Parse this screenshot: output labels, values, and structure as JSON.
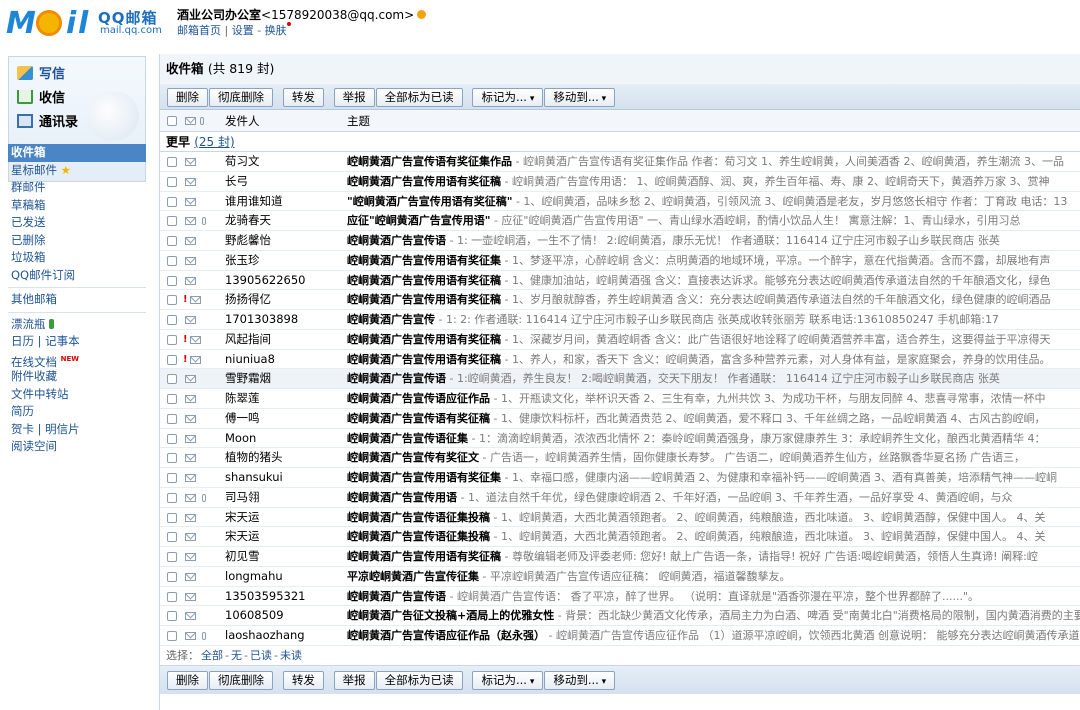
{
  "header": {
    "logo_brand": "QQ邮箱",
    "logo_domain": "mail.qq.com",
    "account_name": "酒业公司办公室",
    "account_email": "<1578920038@qq.com>",
    "link_home": "邮箱首页",
    "link_settings": "设置",
    "link_switch": "换肤"
  },
  "sidebar": {
    "write": "写信",
    "receive": "收信",
    "contacts": "通讯录",
    "folders": [
      "收件箱",
      "星标邮件",
      "群邮件",
      "草稿箱",
      "已发送",
      "已删除",
      "垃圾箱",
      "QQ邮件订阅"
    ],
    "other_mail": "其他邮箱",
    "extras": [
      "漂流瓶",
      "日历 | 记事本",
      "在线文档",
      "附件收藏",
      "文件中转站",
      "简历",
      "贺卡 | 明信片",
      "阅读空间"
    ],
    "new_badge": "NEW"
  },
  "inbox": {
    "title": "收件箱",
    "count_text": "(共 819 封)",
    "col_sender": "发件人",
    "col_subject": "主题",
    "group_label": "更早",
    "group_count": "(25 封)",
    "select_label": "选择：",
    "select_all": "全部",
    "select_none": "无",
    "select_read": "已读",
    "select_unread": "未读"
  },
  "toolbar": {
    "delete": "删除",
    "delete_perm": "彻底删除",
    "forward": "转发",
    "report": "举报",
    "mark_all_read": "全部标为已读",
    "mark_as": "标记为...",
    "move_to": "移动到..."
  },
  "emails": [
    {
      "sender": "荀习文",
      "title": "崆峒黄酒广告宣传语有奖征集作品",
      "preview": " - 崆峒黄酒广告宣传语有奖征集作品 作者：荀习文 1、养生崆峒黄，人间美酒香 2、崆峒黄酒，养生潮流 3、一品",
      "attach": false,
      "flag": false
    },
    {
      "sender": "长弓",
      "title": "崆峒黄酒广告宣传用语有奖征稿",
      "preview": " - 崆峒黄酒广告宣传用语： 1、崆峒黄酒醇、润、爽，养生百年福、寿、康 2、崆峒奇天下，黄酒养万家 3、赏神",
      "attach": false,
      "flag": false
    },
    {
      "sender": "谁用谁知道",
      "title": "\"崆峒黄酒广告宣传用语有奖征稿\"",
      "preview": " - 1、崆峒黄酒，品味乡愁 2、崆峒黄酒，引领风流 3、崆峒黄酒是老友，岁月悠悠长相守 作者：丁育政 电话：13",
      "attach": false,
      "flag": false
    },
    {
      "sender": "龙骑春天",
      "title": "应征\"崆峒黄酒广告宣传用语\"",
      "preview": " - 应征\"崆峒黄酒广告宣传用语\" 一、青山绿水酒崆峒，酌情小饮品人生！ 寓意注解：1、青山绿水，引用习总",
      "attach": true,
      "flag": false
    },
    {
      "sender": "野彪馨怡",
      "title": "崆峒黄酒广告宣传语",
      "preview": " - 1: 一壶崆峒酒，一生不了情！ 2:崆峒黄酒，康乐无忧！ 作者通联：116414 辽宁庄河市毅子山乡联民商店 张英",
      "attach": false,
      "flag": false
    },
    {
      "sender": "张玉珍",
      "title": "崆峒黄酒广告宣传用语有奖征集",
      "preview": " - 1、梦逐平凉，心醉崆峒 含义：点明黄酒的地域环境，平凉。一个醉字，意在代指黄酒。含而不露，却展地有声",
      "attach": false,
      "flag": false
    },
    {
      "sender": "13905622650",
      "title": "崆峒黄酒广告宣传用语有奖征稿",
      "preview": " - 1、健康加油站，崆峒黄酒强 含义：直接表达诉求。能够充分表达崆峒黄酒传承道法自然的千年酿酒文化，绿色",
      "attach": false,
      "flag": false
    },
    {
      "sender": "扬扬得亿",
      "title": "崆峒黄酒广告宣传用语有奖征稿",
      "preview": " - 1、岁月酿就醇香，养生崆峒黄酒 含义：充分表达崆峒黄酒传承道法自然的千年酿酒文化，绿色健康的崆峒酒品",
      "attach": false,
      "flag": true
    },
    {
      "sender": "1701303898",
      "title": "崆峒黄酒广告宣传",
      "preview": " - 1: 2: 作者通联: 116414 辽宁庄河市毅子山乡联民商店 张英成收转张丽芳 联系电话:13610850247 手机邮箱:17",
      "attach": false,
      "flag": false
    },
    {
      "sender": "风起指间",
      "title": "崆峒黄酒广告宣传用语有奖征稿",
      "preview": " - 1、深藏岁月间，黄酒崆峒香 含义：此广告语很好地诠释了崆峒黄酒营养丰富，适合养生，这要得益于平凉得天",
      "attach": false,
      "flag": true
    },
    {
      "sender": "niuniua8",
      "title": "崆峒黄酒广告宣传用语有奖征稿",
      "preview": " - 1、养人，和家，香天下 含义：崆峒黄酒，富含多种营养元素，对人身体有益，是家庭聚会，养身的饮用佳品。",
      "attach": false,
      "flag": true
    },
    {
      "sender": "雪野霜烟",
      "title": "崆峒黄酒广告宣传语",
      "preview": " - 1:崆峒黄酒，养生良友！ 2:喝崆峒黄酒，交天下朋友！ 作者通联： 116414 辽宁庄河市毅子山乡联民商店 张英",
      "attach": false,
      "flag": false
    },
    {
      "sender": "陈翠莲",
      "title": "崆峒黄酒广告宣传语应征作品",
      "preview": " - 1、开瓶读文化，举杯识天香 2、三生有幸，九州共饮 3、为成功干杯，与朋友同醉 4、悲喜寻常事，浓情一杯中",
      "attach": false,
      "flag": false
    },
    {
      "sender": "傅一鸣",
      "title": "崆峒黄酒广告宣传语有奖征稿",
      "preview": " - 1、健康饮料标杆，西北黄酒贵范 2、崆峒黄酒，爱不释口 3、千年丝绸之路，一品崆峒黄酒 4、古风古韵崆峒，",
      "attach": false,
      "flag": false
    },
    {
      "sender": "Moon",
      "title": "崆峒黄酒广告宣传语征集",
      "preview": " - 1：滴滴崆峒黄酒，浓浓西北情怀 2：秦岭崆峒黄酒强身，康万家健康养生 3：承崆峒养生文化，酿西北黄酒精华 4：",
      "attach": false,
      "flag": false
    },
    {
      "sender": "植物的猪头",
      "title": "崆峒黄酒广告宣传有奖征文",
      "preview": " - 广告语一，崆峒黄酒养生情，固你健康长寿梦。 广告语二，崆峒黄酒养生仙方，丝路飘香华夏名扬 广告语三，",
      "attach": false,
      "flag": false
    },
    {
      "sender": "shansukui",
      "title": "崆峒黄酒广告宣传用语有奖征集",
      "preview": " - 1、幸福口感，健康内涵——崆峒黄酒 2、为健康和幸福补钙——崆峒黄酒 3、酒有真善美，培添精气神——崆峒",
      "attach": false,
      "flag": false
    },
    {
      "sender": "司马翎",
      "title": "崆峒黄酒广告宣传用语",
      "preview": " - 1、道法自然千年优，绿色健康崆峒酒 2、千年好酒，一品崆峒 3、千年养生酒，一品好享受 4、黄酒崆峒，与众",
      "attach": true,
      "flag": false
    },
    {
      "sender": "宋天运",
      "title": "崆峒黄酒广告宣传语征集投稿",
      "preview": " - 1、崆峒黄酒，大西北黄酒领跑者。 2、崆峒黄酒，纯粮酿造，西北味道。 3、崆峒黄酒醇，保健中国人。 4、关",
      "attach": false,
      "flag": false
    },
    {
      "sender": "宋天运",
      "title": "崆峒黄酒广告宣传语征集投稿",
      "preview": " - 1、崆峒黄酒，大西北黄酒领跑者。 2、崆峒黄酒，纯粮酿造，西北味道。 3、崆峒黄酒醇，保健中国人。 4、关",
      "attach": false,
      "flag": false
    },
    {
      "sender": "初见雪",
      "title": "崆峒黄酒广告宣传用语有奖征稿",
      "preview": " - 尊敬编辑老师及评委老师: 您好! 献上广告语一条，请指导! 祝好 广告语:喝崆峒黄酒，领悟人生真谛! 阐释:崆",
      "attach": false,
      "flag": false
    },
    {
      "sender": "longmahu",
      "title": "平凉崆峒黄酒广告宣传征集",
      "preview": " - 平凉崆峒黄酒广告宣传语应征稿： 崆峒黄酒，福道馨馥孳友。",
      "attach": false,
      "flag": false
    },
    {
      "sender": "13503595321",
      "title": "崆峒黄酒广告宣传语",
      "preview": " - 崆峒黄酒广告宣传语： 香了平凉，醉了世界。 （说明：直译就是\"酒香弥漫在平凉，整个世界都醉了......\"。",
      "attach": false,
      "flag": false
    },
    {
      "sender": "10608509",
      "title": "崆峒黄酒广告征文投稿+酒局上的优雅女性",
      "preview": " - 背景：西北缺少黄酒文化传承，酒局主力为白酒、啤酒 受\"南黄北白\"消费格局的限制，国内黄酒消费的主要",
      "attach": false,
      "flag": false
    },
    {
      "sender": "laoshaozhang",
      "title": "崆峒黄酒广告宣传语应征作品（赵永强）",
      "preview": " - 崆峒黄酒广告宣传语应征作品 （1）道源平凉崆峒，饮领西北黄酒 创意说明： 能够充分表达崆峒黄酒传承道法",
      "attach": true,
      "flag": false
    }
  ]
}
